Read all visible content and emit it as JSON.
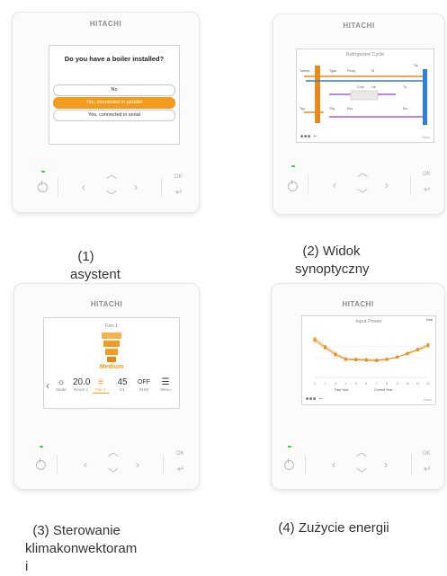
{
  "brand": "HITACHI",
  "controls": {
    "ok": "OK"
  },
  "panels": [
    {
      "caption": "(1)\nasystent",
      "screen": {
        "question": "Do you have a boiler installed?",
        "options": [
          "No",
          "Yes, connected in parallel",
          "Yes, connected in serial"
        ],
        "selected_index": 1
      }
    },
    {
      "caption": "(2) Widok\nsynoptyczny",
      "screen": {
        "title": "Refrigerant Cycle",
        "labels": [
          "Twcmp",
          "Tgas",
          "Pcmp",
          "Td",
          "Tw",
          "Tsg",
          "Tliq",
          "Evo",
          "Cont",
          "Ha",
          "Tz",
          "Evi"
        ],
        "back": "Back"
      }
    },
    {
      "caption": "(3) Sterowanie\nklimakonwektoram\ni",
      "screen": {
        "title": "Fan 1",
        "level": "Medium",
        "items": [
          {
            "value": "☼",
            "label": "Mode"
          },
          {
            "value": "20.0",
            "label": "Room 1"
          },
          {
            "value": "≡",
            "label": "Fan 1"
          },
          {
            "value": "45",
            "label": "C1"
          },
          {
            "value": "OFF",
            "label": "DHW"
          },
          {
            "value": "☰",
            "label": "Menu"
          }
        ],
        "active_index": 2
      }
    },
    {
      "caption": "(4) Zużycie energii",
      "screen": {
        "title": "Input Power",
        "corner": "Total",
        "legend": [
          "Past Year",
          "Current Year"
        ],
        "back": "Back"
      }
    }
  ],
  "chart_data": {
    "type": "line",
    "title": "Input Power",
    "x": [
      1,
      2,
      3,
      4,
      5,
      6,
      7,
      8,
      9,
      10,
      11,
      12
    ],
    "series": [
      {
        "name": "Past Year",
        "values": [
          1000,
          800,
          620,
          480,
          470,
          460,
          450,
          470,
          530,
          600,
          700,
          800
        ],
        "color": "#f0a030"
      },
      {
        "name": "Current Year",
        "values": [
          950,
          760,
          580,
          460,
          450,
          440,
          430,
          460,
          520,
          620,
          720,
          840
        ],
        "color": "#f0a030"
      }
    ],
    "ylim": [
      0,
      1200
    ]
  },
  "colors": {
    "accent": "#f49b1e",
    "led": "#3cc23c",
    "pipe_orange": "#e88a1e",
    "pipe_blue": "#2f7fe0",
    "pipe_purple": "#b45ad0"
  }
}
